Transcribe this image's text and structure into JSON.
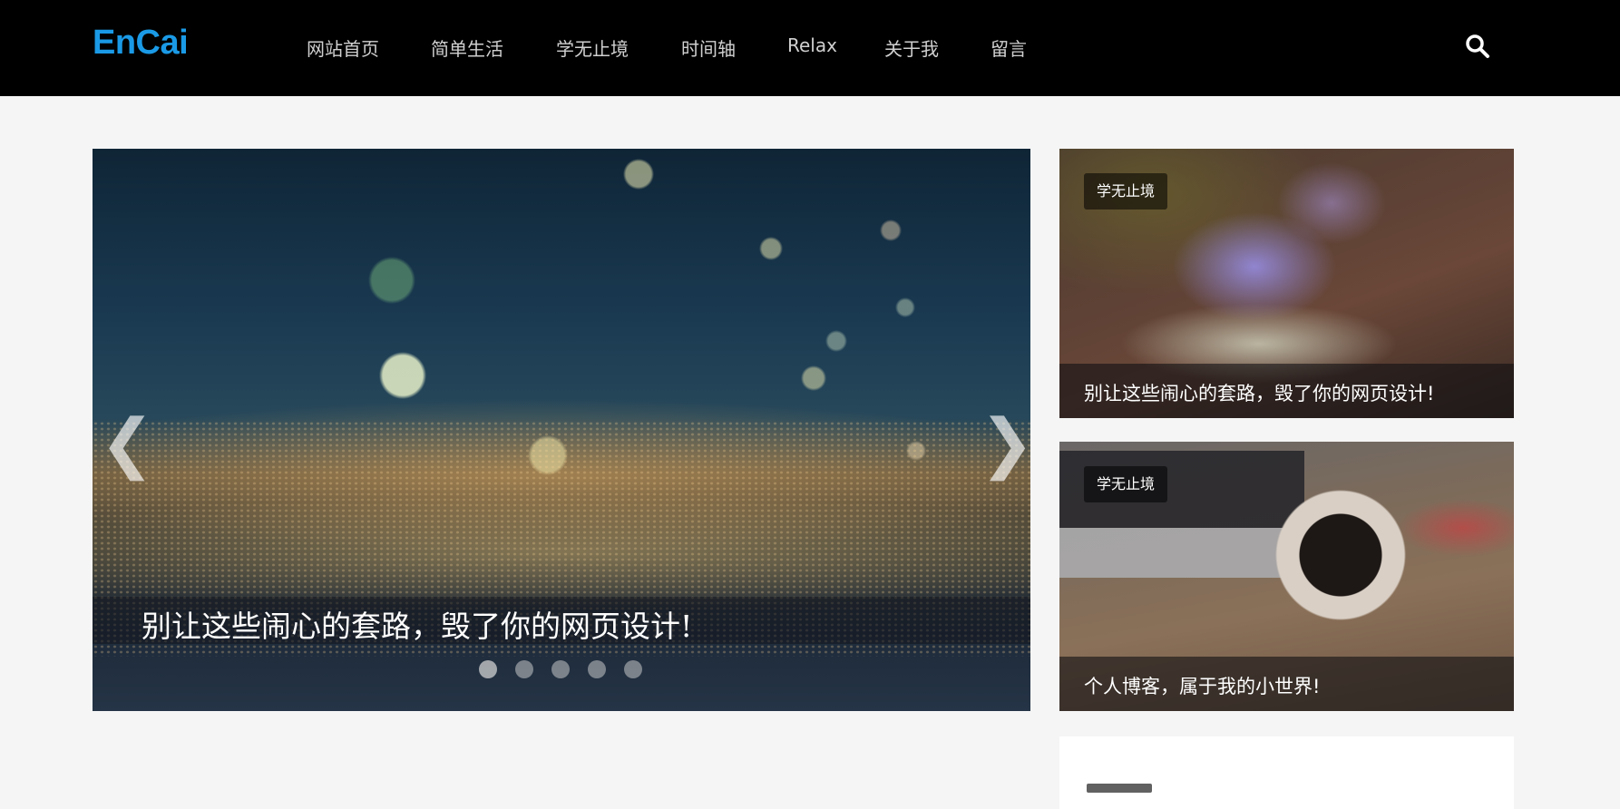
{
  "header": {
    "logo": "EnCai",
    "nav": [
      {
        "label": "网站首页"
      },
      {
        "label": "简单生活"
      },
      {
        "label": "学无止境"
      },
      {
        "label": "时间轴"
      },
      {
        "label": "Relax"
      },
      {
        "label": "关于我"
      },
      {
        "label": "留言"
      }
    ],
    "search_icon": "search-icon",
    "colors": {
      "background": "#000000",
      "logo": "#1a9ae6",
      "nav_text": "#d0d0d0"
    }
  },
  "slider": {
    "caption": "别让这些闹心的套路，毁了你的网页设计!",
    "prev_arrow": "❮",
    "next_arrow": "❯",
    "slide_count": 5,
    "active_slide": 1
  },
  "side_cards": [
    {
      "tag": "学无止境",
      "title": "别让这些闹心的套路，毁了你的网页设计!"
    },
    {
      "tag": "学无止境",
      "title": "个人博客，属于我的小世界!"
    }
  ]
}
